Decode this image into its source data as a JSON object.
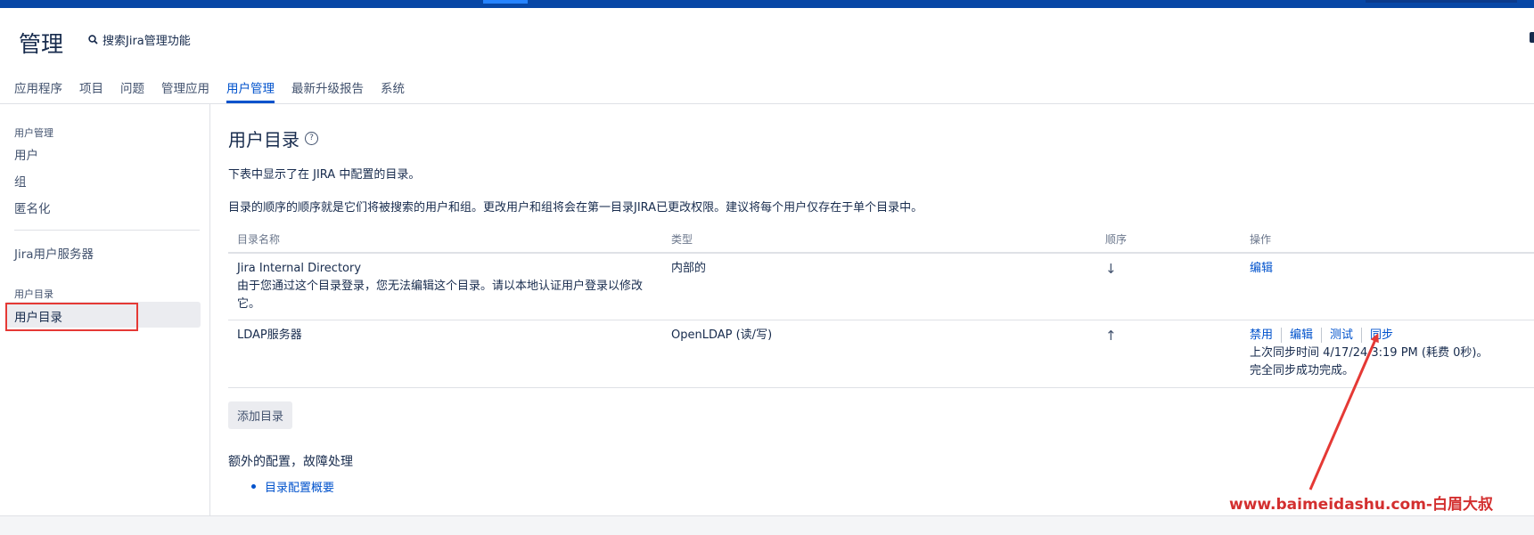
{
  "header": {
    "title": "管理",
    "search_label": "搜索Jira管理功能"
  },
  "tabs": [
    {
      "label": "应用程序"
    },
    {
      "label": "项目"
    },
    {
      "label": "问题"
    },
    {
      "label": "管理应用"
    },
    {
      "label": "用户管理",
      "active": true
    },
    {
      "label": "最新升级报告"
    },
    {
      "label": "系统"
    }
  ],
  "sidebar": {
    "section1_heading": "用户管理",
    "users": "用户",
    "groups": "组",
    "anonymize": "匿名化",
    "jira_user_server": "Jira用户服务器",
    "section2_heading": "用户目录",
    "user_directories": "用户目录"
  },
  "main": {
    "title": "用户目录",
    "help_icon": "question-circle-icon",
    "description1": "下表中显示了在 JIRA 中配置的目录。",
    "description2": "目录的顺序的顺序就是它们将被搜索的用户和组。更改用户和组将会在第一目录JIRA已更改权限。建议将每个用户仅存在于单个目录中。",
    "table": {
      "headers": [
        "目录名称",
        "类型",
        "顺序",
        "操作"
      ],
      "rows": [
        {
          "name": "Jira Internal Directory",
          "note": "由于您通过这个目录登录，您无法编辑这个目录。请以本地认证用户登录以修改它。",
          "type": "内部的",
          "order_icon": "arrow-down-icon",
          "order_glyph": "↓",
          "actions": [
            "编辑"
          ]
        },
        {
          "name": "LDAP服务器",
          "type": "OpenLDAP (读/写)",
          "order_icon": "arrow-up-icon",
          "order_glyph": "↑",
          "actions": [
            "禁用",
            "编辑",
            "测试",
            "同步"
          ],
          "sync_status": "上次同步时间 4/17/24 3:19 PM (耗费 0秒)。",
          "sync_result": "完全同步成功完成。"
        }
      ]
    },
    "add_button": "添加目录",
    "extra_title": "额外的配置，故障处理",
    "extra_link": "目录配置概要"
  },
  "annotation": {
    "watermark": "www.baimeidashu.com-白眉大叔",
    "color": "#e53935"
  }
}
